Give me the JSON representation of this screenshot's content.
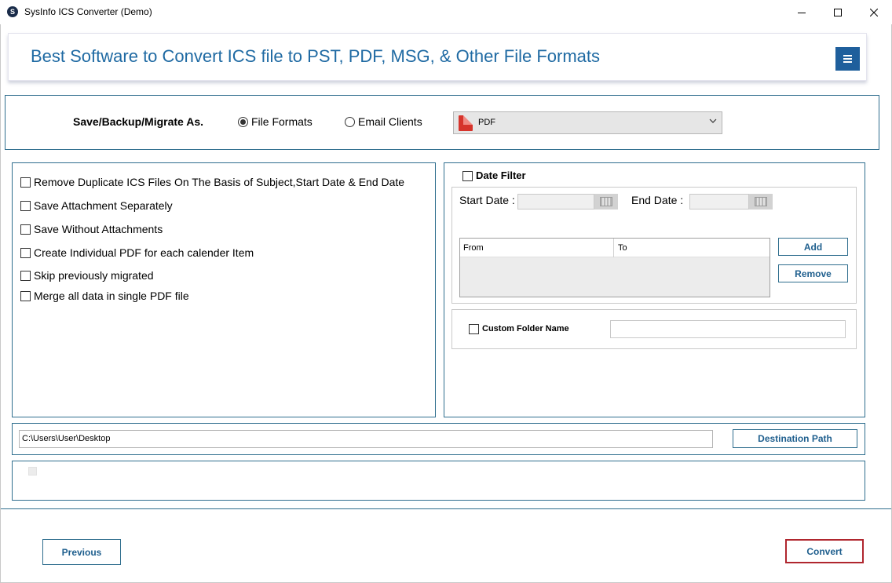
{
  "window": {
    "title": "SysInfo ICS Converter (Demo)",
    "minimize_icon": "minimize-icon",
    "maximize_icon": "maximize-icon",
    "close_icon": "close-icon"
  },
  "header": {
    "title": "Best Software to Convert ICS file to PST, PDF, MSG, & Other File Formats",
    "menu_icon": "hamburger-icon"
  },
  "save_as": {
    "label": "Save/Backup/Migrate As.",
    "options": [
      {
        "label": "File Formats",
        "selected": true
      },
      {
        "label": "Email Clients",
        "selected": false
      }
    ],
    "format_value": "PDF",
    "format_icon": "pdf-file-icon"
  },
  "options": [
    {
      "label": "Remove Duplicate ICS Files On The Basis of Subject,Start Date & End Date",
      "checked": false
    },
    {
      "label": "Save Attachment Separately",
      "checked": false
    },
    {
      "label": "Save Without Attachments",
      "checked": false
    },
    {
      "label": "Create Individual PDF for each calender Item",
      "checked": false
    },
    {
      "label": "Skip previously migrated",
      "checked": false
    },
    {
      "label": "Merge all data in single PDF file",
      "checked": false
    }
  ],
  "date_filter": {
    "label": "Date Filter",
    "start_label": "Start Date :",
    "end_label": "End Date :",
    "start_value": "",
    "end_value": "",
    "columns": [
      "From",
      "To"
    ],
    "add_label": "Add",
    "remove_label": "Remove"
  },
  "custom_folder": {
    "label": "Custom Folder Name",
    "value": ""
  },
  "destination": {
    "path": "C:\\Users\\User\\Desktop",
    "button_label": "Destination Path"
  },
  "footer": {
    "previous_label": "Previous",
    "convert_label": "Convert"
  },
  "colors": {
    "accent": "#1f6aa3",
    "panel_border": "#2f6e8e",
    "convert_border": "#b0262e"
  }
}
